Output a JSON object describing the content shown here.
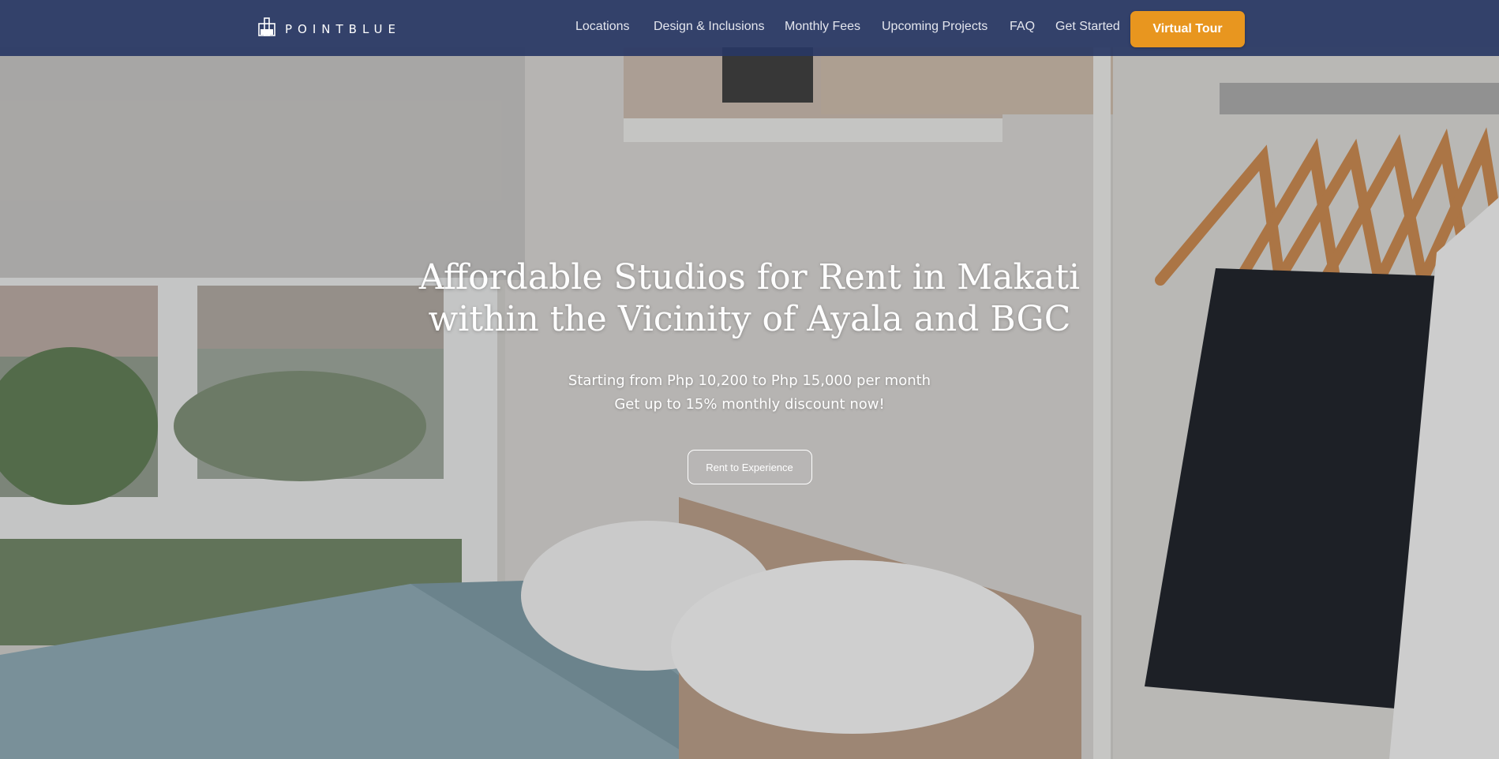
{
  "brand": {
    "name": "POINTBLUE",
    "logo_icon": "building-logo-icon"
  },
  "nav": {
    "links": [
      "Locations",
      "Design & Inclusions",
      "Monthly Fees",
      "Upcoming Projects",
      "FAQ",
      "Get Started"
    ],
    "cta_label": "Virtual Tour"
  },
  "hero": {
    "title_line1": "Affordable Studios for Rent in Makati",
    "title_line2": "within the Vicinity of Ayala and BGC",
    "subtitle_line1": "Starting from Php 10,200 to Php 15,000 per month",
    "subtitle_line2": "Get up to 15% monthly discount now!",
    "cta_label": "Rent to Experience"
  },
  "colors": {
    "navbar": "#283764",
    "accent": "#e8961f",
    "text_light": "#ffffff"
  }
}
